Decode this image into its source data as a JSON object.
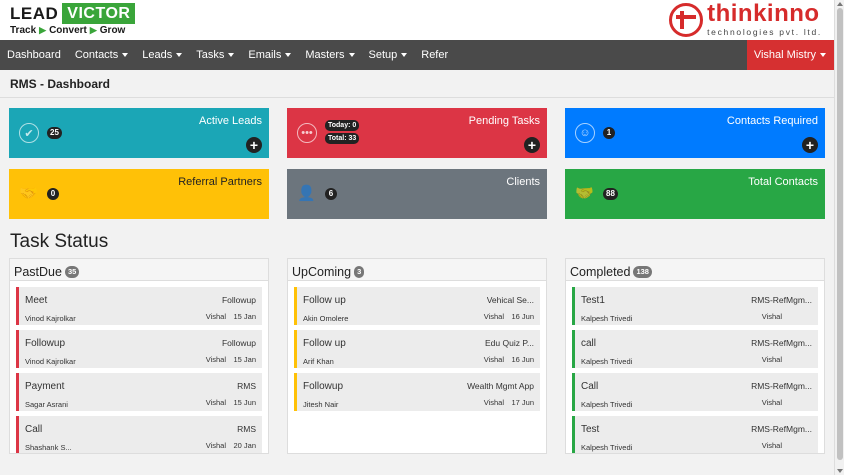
{
  "header": {
    "logo_lead": "LEAD",
    "logo_victor": "VICTOR",
    "tagline": [
      "Track",
      "Convert",
      "Grow"
    ],
    "brand_name": "thinkinno",
    "brand_sub": "technologies pvt. ltd."
  },
  "nav": {
    "items": [
      {
        "label": "Dashboard",
        "dropdown": false
      },
      {
        "label": "Contacts",
        "dropdown": true
      },
      {
        "label": "Leads",
        "dropdown": true
      },
      {
        "label": "Tasks",
        "dropdown": true
      },
      {
        "label": "Emails",
        "dropdown": true
      },
      {
        "label": "Masters",
        "dropdown": true
      },
      {
        "label": "Setup",
        "dropdown": true
      },
      {
        "label": "Refer",
        "dropdown": false
      }
    ],
    "user": "Vishal Mistry"
  },
  "page_title": "RMS - Dashboard",
  "cards": {
    "active_leads": {
      "title": "Active Leads",
      "count": "25",
      "color": "#1ba6b6"
    },
    "pending_tasks": {
      "title": "Pending Tasks",
      "today": "Today: 0",
      "total": "Total: 33",
      "color": "#dc3545"
    },
    "contacts_required": {
      "title": "Contacts Required",
      "count": "1",
      "color": "#007bff"
    },
    "referral_partners": {
      "title": "Referral Partners",
      "count": "0",
      "color": "#ffc107"
    },
    "clients": {
      "title": "Clients",
      "count": "6",
      "color": "#6c757d"
    },
    "total_contacts": {
      "title": "Total Contacts",
      "count": "88",
      "color": "#28a745"
    }
  },
  "task_status": {
    "heading": "Task Status",
    "pastdue": {
      "title": "PastDue",
      "count": "35",
      "accent": "#dc3545",
      "items": [
        {
          "title": "Meet",
          "person": "Vinod Kajrolkar",
          "category": "Followup",
          "owner": "Vishal",
          "date": "15 Jan"
        },
        {
          "title": "Followup",
          "person": "Vinod Kajrolkar",
          "category": "Followup",
          "owner": "Vishal",
          "date": "15 Jan"
        },
        {
          "title": "Payment",
          "person": "Sagar Asrani",
          "category": "RMS",
          "owner": "Vishal",
          "date": "15 Jun"
        },
        {
          "title": "Call",
          "person": "Shashank S...",
          "category": "RMS",
          "owner": "Vishal",
          "date": "20 Jan"
        }
      ]
    },
    "upcoming": {
      "title": "UpComing",
      "count": "3",
      "accent": "#ffc107",
      "items": [
        {
          "title": "Follow up",
          "person": "Akin Omolere",
          "category": "Vehical Se...",
          "owner": "Vishal",
          "date": "16 Jun"
        },
        {
          "title": "Follow up",
          "person": "Arif Khan",
          "category": "Edu Quiz P...",
          "owner": "Vishal",
          "date": "16 Jun"
        },
        {
          "title": "Followup",
          "person": "Jitesh Nair",
          "category": "Wealth Mgmt App",
          "owner": "Vishal",
          "date": "17 Jun"
        }
      ]
    },
    "completed": {
      "title": "Completed",
      "count": "138",
      "accent": "#28a745",
      "items": [
        {
          "title": "Test1",
          "person": "Kalpesh Trivedi",
          "category": "RMS-RefMgm...",
          "owner": "Vishal"
        },
        {
          "title": "call",
          "person": "Kalpesh Trivedi",
          "category": "RMS-RefMgm...",
          "owner": "Vishal"
        },
        {
          "title": "Call",
          "person": "Kalpesh Trivedi",
          "category": "RMS-RefMgm...",
          "owner": "Vishal"
        },
        {
          "title": "Test",
          "person": "Kalpesh Trivedi",
          "category": "RMS-RefMgm...",
          "owner": "Vishal"
        }
      ]
    }
  }
}
